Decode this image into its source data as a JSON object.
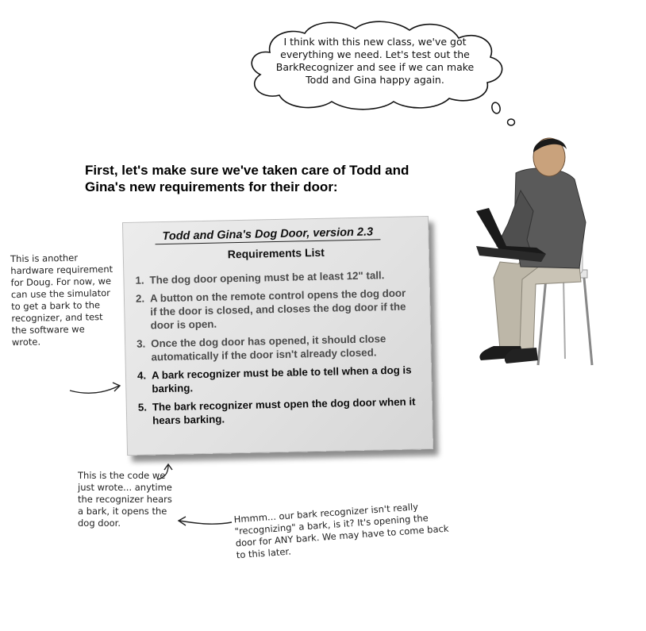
{
  "thought_bubble": {
    "text": "I think with this new class, we've got everything we need. Let's test out the BarkRecognizer and see if we can make Todd and Gina happy again."
  },
  "heading": "First, let's make sure we've taken care of Todd and Gina's new requirements for their door:",
  "requirements_card": {
    "title": "Todd and Gina's Dog Door, version 2.3",
    "subtitle": "Requirements List",
    "items": [
      {
        "num": "1.",
        "text": "The dog door opening must be at least 12\" tall."
      },
      {
        "num": "2.",
        "text": "A button on the remote control opens the dog door if the door is closed, and closes the dog door if the door is open."
      },
      {
        "num": "3.",
        "text": "Once the dog door has opened, it should close automatically if the door isn't already closed."
      },
      {
        "num": "4.",
        "text": "A bark recognizer must be able to tell when a dog is barking."
      },
      {
        "num": "5.",
        "text": "The bark recognizer must open the dog door when it hears barking."
      }
    ]
  },
  "notes": {
    "hardware": "This is another hardware requirement for Doug. For now, we can use the simulator to get a bark to the recognizer, and test the software we wrote.",
    "code": "This is the code we just wrote... anytime the recognizer hears a bark, it opens the dog door.",
    "hmm": "Hmmm... our bark recognizer isn't really \"recognizing\" a bark, is it? It's opening the door for ANY bark. We may have to come back to this later."
  }
}
